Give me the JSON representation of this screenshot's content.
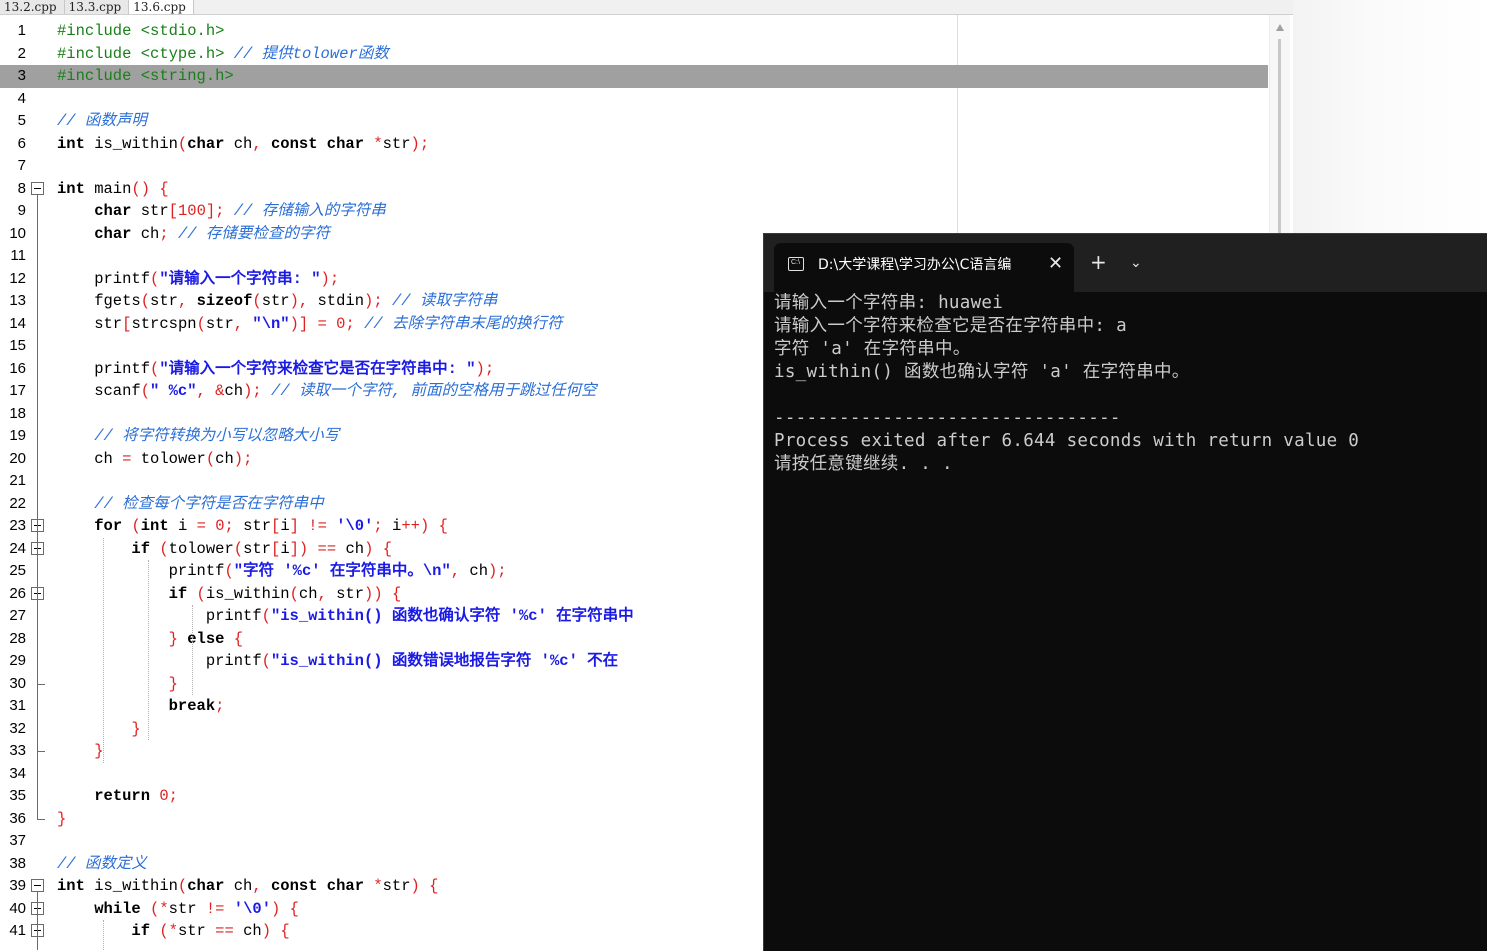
{
  "editor": {
    "tabs": [
      "13.2.cpp",
      "13.3.cpp",
      "13.6.cpp"
    ],
    "active_tab": 2,
    "lines": [
      {
        "n": "1",
        "h": "<span class=\"pp\">#include &lt;stdio.h&gt;</span>"
      },
      {
        "n": "2",
        "h": "<span class=\"pp\">#include &lt;ctype.h&gt;</span> <span class=\"cm\">// 提供tolower函数</span>"
      },
      {
        "n": "3",
        "h": "<span class=\"pp\">#include &lt;string.h&gt;</span>"
      },
      {
        "n": "4",
        "h": ""
      },
      {
        "n": "5",
        "h": "<span class=\"cm\">// 函数声明</span>"
      },
      {
        "n": "6",
        "h": "<span class=\"kw\">int</span> is_within<span class=\"op\">(</span><span class=\"kw\">char</span> ch<span class=\"op\">,</span> <span class=\"kw\">const char</span> <span class=\"op\">*</span>str<span class=\"op\">);</span>"
      },
      {
        "n": "7",
        "h": ""
      },
      {
        "n": "8",
        "h": "<span class=\"kw\">int</span> main<span class=\"op\">()</span> <span class=\"op\">{</span>"
      },
      {
        "n": "9",
        "h": "    <span class=\"kw\">char</span> str<span class=\"op\">[</span><span class=\"nm\">100</span><span class=\"op\">];</span> <span class=\"cm\">// 存储输入的字符串</span>"
      },
      {
        "n": "10",
        "h": "    <span class=\"kw\">char</span> ch<span class=\"op\">;</span> <span class=\"cm\">// 存储要检查的字符</span>"
      },
      {
        "n": "11",
        "h": ""
      },
      {
        "n": "12",
        "h": "    printf<span class=\"op\">(</span><span class=\"st\">\"请输入一个字符串: \"</span><span class=\"op\">);</span>"
      },
      {
        "n": "13",
        "h": "    fgets<span class=\"op\">(</span>str<span class=\"op\">,</span> <span class=\"kw\">sizeof</span><span class=\"op\">(</span>str<span class=\"op\">),</span> stdin<span class=\"op\">);</span> <span class=\"cm\">// 读取字符串</span>"
      },
      {
        "n": "14",
        "h": "    str<span class=\"op\">[</span>strcspn<span class=\"op\">(</span>str<span class=\"op\">,</span> <span class=\"st\">\"\\n\"</span><span class=\"op\">)]</span> <span class=\"op\">=</span> <span class=\"nm\">0</span><span class=\"op\">;</span> <span class=\"cm\">// 去除字符串末尾的换行符</span>"
      },
      {
        "n": "15",
        "h": ""
      },
      {
        "n": "16",
        "h": "    printf<span class=\"op\">(</span><span class=\"st\">\"请输入一个字符来检查它是否在字符串中: \"</span><span class=\"op\">);</span>"
      },
      {
        "n": "17",
        "h": "    scanf<span class=\"op\">(</span><span class=\"st\">\" %c\"</span><span class=\"op\">,</span> <span class=\"op\">&amp;</span>ch<span class=\"op\">);</span> <span class=\"cm\">// 读取一个字符, 前面的空格用于跳过任何空</span>"
      },
      {
        "n": "18",
        "h": ""
      },
      {
        "n": "19",
        "h": "    <span class=\"cm\">// 将字符转换为小写以忽略大小写</span>"
      },
      {
        "n": "20",
        "h": "    ch <span class=\"op\">=</span> tolower<span class=\"op\">(</span>ch<span class=\"op\">);</span>"
      },
      {
        "n": "21",
        "h": ""
      },
      {
        "n": "22",
        "h": "    <span class=\"cm\">// 检查每个字符是否在字符串中</span>"
      },
      {
        "n": "23",
        "h": "    <span class=\"kw\">for</span> <span class=\"op\">(</span><span class=\"kw\">int</span> i <span class=\"op\">=</span> <span class=\"nm\">0</span><span class=\"op\">;</span> str<span class=\"op\">[</span>i<span class=\"op\">]</span> <span class=\"op\">!=</span> <span class=\"st\">'\\0'</span><span class=\"op\">;</span> i<span class=\"op\">++)</span> <span class=\"op\">{</span>"
      },
      {
        "n": "24",
        "h": "        <span class=\"kw\">if</span> <span class=\"op\">(</span>tolower<span class=\"op\">(</span>str<span class=\"op\">[</span>i<span class=\"op\">])</span> <span class=\"op\">==</span> ch<span class=\"op\">)</span> <span class=\"op\">{</span>"
      },
      {
        "n": "25",
        "h": "            printf<span class=\"op\">(</span><span class=\"st\">\"字符 '%c' 在字符串中。\\n\"</span><span class=\"op\">,</span> ch<span class=\"op\">);</span>"
      },
      {
        "n": "26",
        "h": "            <span class=\"kw\">if</span> <span class=\"op\">(</span>is_within<span class=\"op\">(</span>ch<span class=\"op\">,</span> str<span class=\"op\">))</span> <span class=\"op\">{</span>"
      },
      {
        "n": "27",
        "h": "                printf<span class=\"op\">(</span><span class=\"st\">\"is_within() 函数也确认字符 '%c' 在字符串中</span>"
      },
      {
        "n": "28",
        "h": "            <span class=\"op\">}</span> <span class=\"kw\">else</span> <span class=\"op\">{</span>"
      },
      {
        "n": "29",
        "h": "                printf<span class=\"op\">(</span><span class=\"st\">\"is_within() 函数错误地报告字符 '%c' 不在</span>"
      },
      {
        "n": "30",
        "h": "            <span class=\"op\">}</span>"
      },
      {
        "n": "31",
        "h": "            <span class=\"kw\">break</span><span class=\"op\">;</span>"
      },
      {
        "n": "32",
        "h": "        <span class=\"op\">}</span>"
      },
      {
        "n": "33",
        "h": "    <span class=\"op\">}</span>"
      },
      {
        "n": "34",
        "h": ""
      },
      {
        "n": "35",
        "h": "    <span class=\"kw\">return</span> <span class=\"nm\">0</span><span class=\"op\">;</span>"
      },
      {
        "n": "36",
        "h": "<span class=\"op\">}</span>"
      },
      {
        "n": "37",
        "h": ""
      },
      {
        "n": "38",
        "h": "<span class=\"cm\">// 函数定义</span>"
      },
      {
        "n": "39",
        "h": "<span class=\"kw\">int</span> is_within<span class=\"op\">(</span><span class=\"kw\">char</span> ch<span class=\"op\">,</span> <span class=\"kw\">const char</span> <span class=\"op\">*</span>str<span class=\"op\">)</span> <span class=\"op\">{</span>"
      },
      {
        "n": "40",
        "h": "    <span class=\"kw\">while</span> <span class=\"op\">(*</span>str <span class=\"op\">!=</span> <span class=\"st\">'\\0'</span><span class=\"op\">)</span> <span class=\"op\">{</span>"
      },
      {
        "n": "41",
        "h": "        <span class=\"kw\">if</span> <span class=\"op\">(*</span>str <span class=\"op\">==</span> ch<span class=\"op\">)</span> <span class=\"op\">{</span>"
      }
    ]
  },
  "terminal": {
    "tab_title": "D:\\大学课程\\学习办公\\C语言编",
    "tab_icon_label": "C:\\",
    "close_glyph": "✕",
    "new_tab_glyph": "+",
    "dropdown_glyph": "⌄",
    "output": [
      "请输入一个字符串: huawei",
      "请输入一个字符来检查它是否在字符串中: a",
      "字符 'a' 在字符串中。",
      "is_within() 函数也确认字符 'a' 在字符串中。",
      "",
      "--------------------------------",
      "Process exited after 6.644 seconds with return value 0",
      "请按任意键继续. . ."
    ]
  }
}
